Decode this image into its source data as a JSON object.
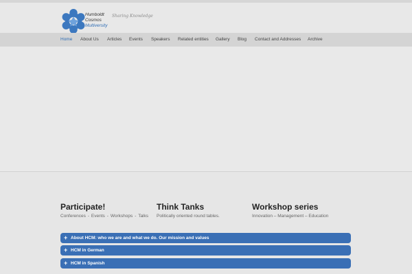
{
  "brand": {
    "line1": "Humboldt",
    "line2": "Cosmos",
    "line3": "Multiversity",
    "tagline": "Sharing Knowledge"
  },
  "nav": {
    "items": [
      {
        "label": "Home",
        "active": true
      },
      {
        "label": "About Us"
      },
      {
        "label": "Articles"
      },
      {
        "label": "Events"
      },
      {
        "label": "Speakers"
      },
      {
        "label": "Related entities"
      },
      {
        "label": "Gallery"
      },
      {
        "label": "Blog"
      },
      {
        "label": "Contact and Addresses"
      },
      {
        "label": "Archive"
      }
    ]
  },
  "features": [
    {
      "title": "Participate!",
      "text": "Conferences - Events - Workshops - Talks"
    },
    {
      "title": "Think Tanks",
      "text": "Politically oriented round tables."
    },
    {
      "title": "Workshop series",
      "text": "Innovation – Management – Education"
    }
  ],
  "accordion": [
    {
      "label": "About HCM: who we are and what we do. Our mission and values"
    },
    {
      "label": "HCM in German"
    },
    {
      "label": "HCM in Spanish"
    }
  ],
  "colors": {
    "accent": "#2f6db5",
    "accordion_bg": "#3a6fb5",
    "nav_bg": "#d4d4d4",
    "page_bg": "#e6e6e6"
  },
  "icons": {
    "logo": "star-ring-logo",
    "accordion_toggle": "plus-icon"
  }
}
